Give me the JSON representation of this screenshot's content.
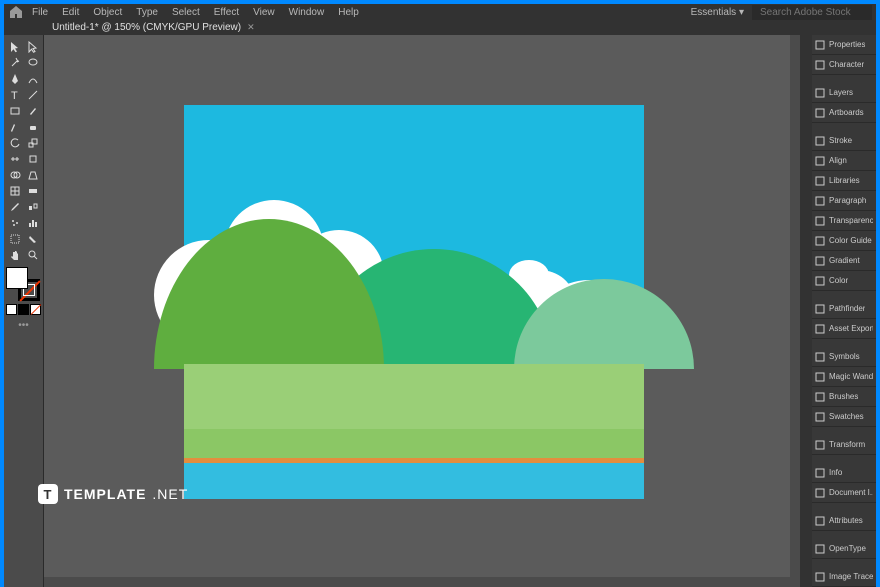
{
  "menubar": {
    "items": [
      "File",
      "Edit",
      "Object",
      "Type",
      "Select",
      "Effect",
      "View",
      "Window",
      "Help"
    ],
    "workspace": "Essentials",
    "search_placeholder": "Search Adobe Stock"
  },
  "tab": {
    "label": "Untitled-1* @ 150% (CMYK/GPU Preview)"
  },
  "panels": [
    {
      "icon": "props",
      "label": "Properties"
    },
    {
      "icon": "char",
      "label": "Character"
    },
    {
      "icon": "layers",
      "label": "Layers",
      "sep": true
    },
    {
      "icon": "artboards",
      "label": "Artboards"
    },
    {
      "icon": "stroke",
      "label": "Stroke",
      "sep": true
    },
    {
      "icon": "align",
      "label": "Align"
    },
    {
      "icon": "libraries",
      "label": "Libraries"
    },
    {
      "icon": "para",
      "label": "Paragraph"
    },
    {
      "icon": "trans",
      "label": "Transparency"
    },
    {
      "icon": "cguide",
      "label": "Color Guide"
    },
    {
      "icon": "grad",
      "label": "Gradient"
    },
    {
      "icon": "color",
      "label": "Color"
    },
    {
      "icon": "pf",
      "label": "Pathfinder",
      "sep": true
    },
    {
      "icon": "ae",
      "label": "Asset Export"
    },
    {
      "icon": "sym",
      "label": "Symbols",
      "sep": true
    },
    {
      "icon": "mw",
      "label": "Magic Wand"
    },
    {
      "icon": "br",
      "label": "Brushes"
    },
    {
      "icon": "sw",
      "label": "Swatches"
    },
    {
      "icon": "tf",
      "label": "Transform",
      "sep": true
    },
    {
      "icon": "info",
      "label": "Info",
      "sep": true
    },
    {
      "icon": "dl",
      "label": "Document I..."
    },
    {
      "icon": "attr",
      "label": "Attributes",
      "sep": true
    },
    {
      "icon": "ot",
      "label": "OpenType",
      "sep": true
    },
    {
      "icon": "it",
      "label": "Image Trace",
      "sep": true
    }
  ],
  "watermark": {
    "text": "TEMPLATE",
    "suffix": ".NET"
  },
  "tools": [
    "selection",
    "direct-selection",
    "magic-wand",
    "lasso",
    "pen",
    "curvature",
    "type",
    "line",
    "rectangle",
    "paintbrush",
    "shaper",
    "eraser",
    "rotate",
    "scale",
    "width",
    "free-transform",
    "shape-builder",
    "perspective",
    "mesh",
    "gradient",
    "eyedropper",
    "blend",
    "symbol-sprayer",
    "column-graph",
    "artboard",
    "slice",
    "hand",
    "zoom"
  ]
}
